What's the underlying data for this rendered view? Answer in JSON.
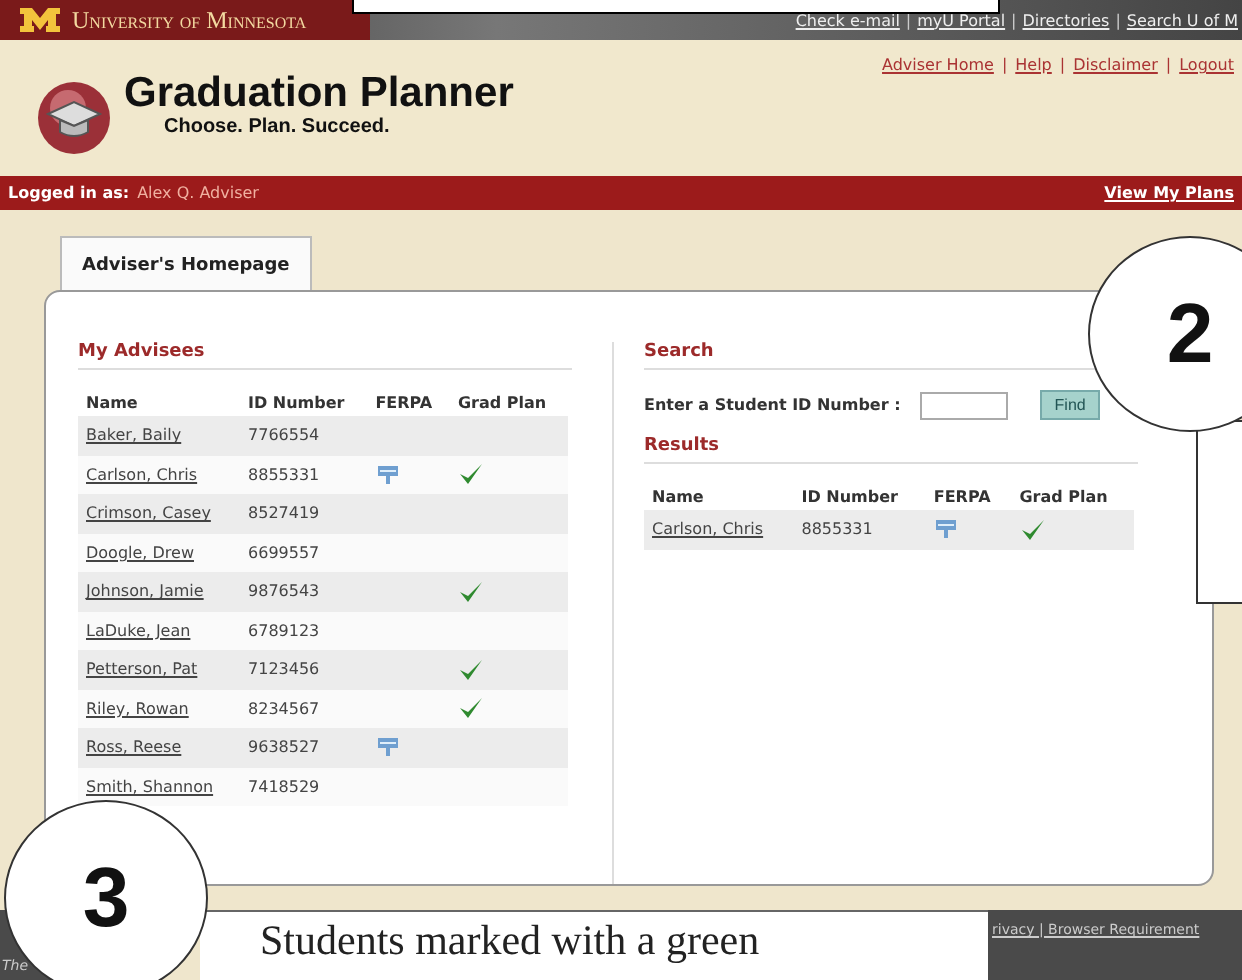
{
  "header": {
    "university": "University of Minnesota",
    "top_links": [
      "Check e-mail",
      "myU Portal",
      "Directories",
      "Search U of M"
    ]
  },
  "site": {
    "title": "Graduation Planner",
    "tagline": "Choose. Plan. Succeed.",
    "links": [
      "Adviser Home",
      "Help",
      "Disclaimer",
      "Logout"
    ]
  },
  "user_bar": {
    "label": "Logged in as:",
    "user": "Alex Q. Adviser",
    "link": "View My Plans"
  },
  "tabs": [
    {
      "label": "Adviser's Homepage",
      "selected": true
    }
  ],
  "advisees": {
    "title": "My Advisees",
    "columns": [
      "Name",
      "ID Number",
      "FERPA",
      "Grad Plan"
    ],
    "rows": [
      {
        "name": "Baker, Baily",
        "id": "7766554",
        "ferpa": false,
        "grad_plan": false
      },
      {
        "name": "Carlson, Chris",
        "id": "8855331",
        "ferpa": true,
        "grad_plan": true
      },
      {
        "name": "Crimson, Casey",
        "id": "8527419",
        "ferpa": false,
        "grad_plan": false
      },
      {
        "name": "Doogle, Drew",
        "id": "6699557",
        "ferpa": false,
        "grad_plan": false
      },
      {
        "name": "Johnson, Jamie",
        "id": "9876543",
        "ferpa": false,
        "grad_plan": true
      },
      {
        "name": "LaDuke, Jean",
        "id": "6789123",
        "ferpa": false,
        "grad_plan": false
      },
      {
        "name": "Petterson, Pat",
        "id": "7123456",
        "ferpa": false,
        "grad_plan": true
      },
      {
        "name": "Riley, Rowan",
        "id": "8234567",
        "ferpa": false,
        "grad_plan": true
      },
      {
        "name": "Ross, Reese",
        "id": "9638527",
        "ferpa": true,
        "grad_plan": false
      },
      {
        "name": "Smith, Shannon",
        "id": "7418529",
        "ferpa": false,
        "grad_plan": false
      }
    ]
  },
  "search": {
    "title": "Search",
    "label": "Enter a Student ID Number :",
    "button": "Find"
  },
  "results": {
    "title": "Results",
    "columns": [
      "Name",
      "ID Number",
      "FERPA",
      "Grad Plan"
    ],
    "rows": [
      {
        "name": "Carlson, Chris",
        "id": "8855331",
        "ferpa": true,
        "grad_plan": true
      }
    ]
  },
  "separator": "|",
  "footer": {
    "left": "The",
    "right": "rivacy | Browser Requirement"
  },
  "callouts": [
    "2",
    "3"
  ],
  "caption": "Students marked with a green"
}
